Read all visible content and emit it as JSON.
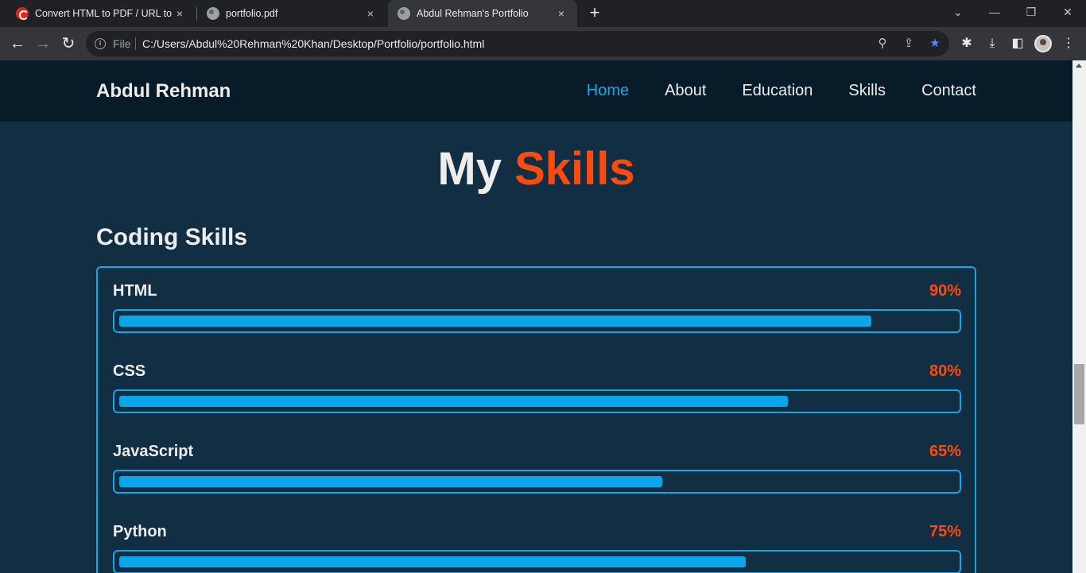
{
  "browser": {
    "tabs": [
      {
        "title": "Convert HTML to PDF / URL to PDF",
        "close": "×"
      },
      {
        "title": "portfolio.pdf",
        "close": "×"
      },
      {
        "title": "Abdul Rehman's Portfolio",
        "close": "×"
      }
    ],
    "new_tab": "+",
    "window_controls": {
      "tab_search": "⌄",
      "minimize": "—",
      "restore": "❐",
      "close": "✕"
    },
    "nav": {
      "back": "←",
      "forward": "→",
      "reload": "↻"
    },
    "omnibox": {
      "info": "i",
      "scheme": "File",
      "url": "C:/Users/Abdul%20Rehman%20Khan/Desktop/Portfolio/portfolio.html",
      "zoom_icon": "⚲",
      "share_icon": "⇪",
      "bookmark_icon": "★"
    },
    "toolbar_icons": {
      "extensions": "✱",
      "download": "⤓",
      "side_panel": "◧",
      "menu": "⋮"
    },
    "colors": {
      "bookmark_star": "#4c8df6"
    }
  },
  "site": {
    "logo": "Abdul Rehman",
    "nav": [
      {
        "label": "Home",
        "active": true
      },
      {
        "label": "About"
      },
      {
        "label": "Education"
      },
      {
        "label": "Skills"
      },
      {
        "label": "Contact"
      }
    ],
    "section_title": {
      "main": "My",
      "accent": "Skills"
    },
    "sub_title": "Coding Skills",
    "skills": [
      {
        "name": "HTML",
        "percent_label": "90%",
        "level": 0.9
      },
      {
        "name": "CSS",
        "percent_label": "80%",
        "level": 0.8
      },
      {
        "name": "JavaScript",
        "percent_label": "65%",
        "level": 0.65
      },
      {
        "name": "Python",
        "percent_label": "75%",
        "level": 0.75
      }
    ],
    "colors": {
      "background": "#112e42",
      "header": "#081b29",
      "accent": "#fc4a10",
      "primary": "#1aa3e6",
      "text": "#ededed"
    }
  }
}
